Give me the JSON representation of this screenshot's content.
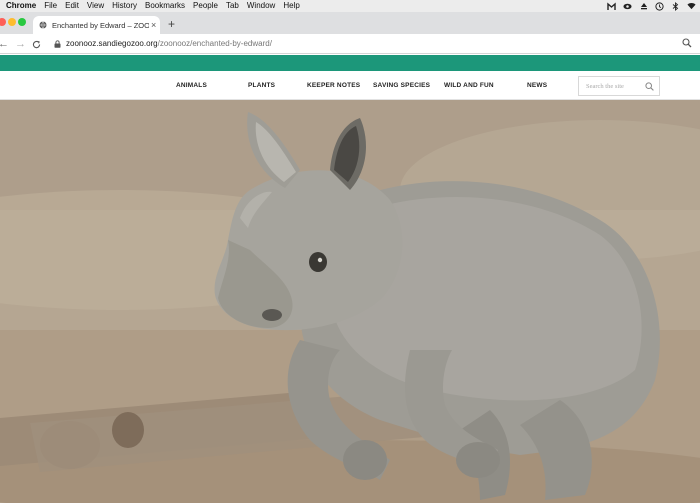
{
  "menubar": {
    "app": "Chrome",
    "items": [
      "File",
      "Edit",
      "View",
      "History",
      "Bookmarks",
      "People",
      "Tab",
      "Window",
      "Help"
    ],
    "tray_icons": [
      "malwarebytes-icon",
      "creative-cloud-icon",
      "eject-icon",
      "time-machine-icon",
      "bluetooth-icon",
      "wifi-icon"
    ]
  },
  "tab": {
    "title": "Enchanted by Edward – ZOONOOZ",
    "close": "×",
    "new_tab": "+"
  },
  "toolbar": {
    "back": "←",
    "forward": "→",
    "reload": "C",
    "url_host": "zoonooz.sandiegozoo.org",
    "url_path": "/zoonooz/enchanted-by-edward/"
  },
  "site": {
    "brand_color": "#1c977a",
    "nav": [
      "ANIMALS",
      "PLANTS",
      "KEEPER NOTES",
      "SAVING SPECIES",
      "WILD AND FUN",
      "NEWS"
    ],
    "search_placeholder": "Search the site"
  },
  "hero": {
    "subject": "baby-rhino-photo"
  }
}
